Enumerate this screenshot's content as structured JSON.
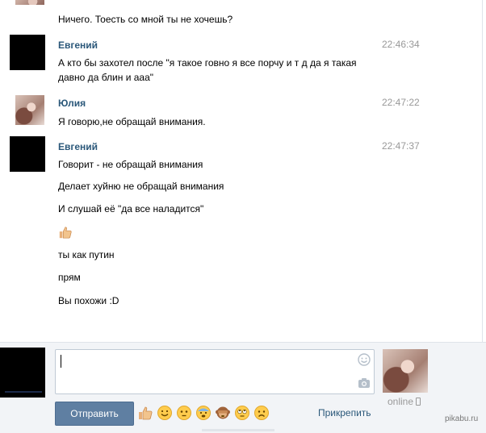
{
  "colors": {
    "name_link": "#2b587a",
    "send_button": "#5f7fa2",
    "composer_bg": "#f2f4f7",
    "time": "#999999"
  },
  "messages": [
    {
      "id": "m0",
      "sender": "",
      "time": "",
      "lines": [
        "Ничего. Тоесть со мной ты не хочешь?"
      ]
    },
    {
      "id": "m1",
      "sender": "Евгений",
      "time": "22:46:34",
      "lines": [
        "А кто бы захотел после \"я такое говно я все порчу и т д да я такая давно да блин и ааа\""
      ]
    },
    {
      "id": "m2",
      "sender": "Юлия",
      "time": "22:47:22",
      "lines": [
        "Я говорю,не обращай внимания."
      ]
    },
    {
      "id": "m3",
      "sender": "Евгений",
      "time": "22:47:37",
      "lines": [
        "Говорит - не обращай внимания",
        "Делает хуйню не обращай внимания",
        "И слушай её \"да все наладится\"",
        "",
        "ты как путин",
        "прям",
        "Вы похожи :D"
      ]
    }
  ],
  "composer": {
    "input_value": "",
    "send_label": "Отправить",
    "attach_label": "Прикрепить",
    "emoji_icons": [
      "thumbs-up-icon",
      "smile-icon",
      "neutral-face-icon",
      "fearful-face-icon",
      "monkey-icon",
      "rolling-eyes-icon",
      "sad-face-icon"
    ]
  },
  "friend": {
    "status": "online"
  },
  "watermark": "pikabu.ru"
}
